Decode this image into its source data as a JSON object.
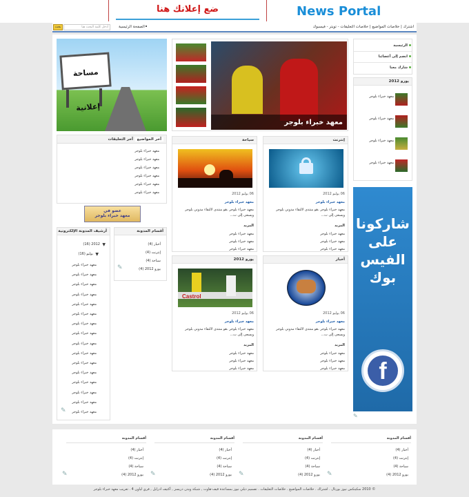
{
  "header": {
    "ad_text": "ضع إعلانك هنا",
    "logo_text": "News Portal"
  },
  "nav": {
    "left_item": "الصفحة الرئيسية",
    "search_button": "بحث",
    "search_placeholder": "أدخل كلمة البحث هنا",
    "right_links": "اشترك | خلاصات المواضيع | خلاصات التعليقات - تويتر - فيسبوك"
  },
  "right_sidebar": {
    "menu": [
      "الرئيسية",
      "انضم إلى أعضائنا",
      "شارك معنا"
    ],
    "section_title": "يورو 2012",
    "items": [
      "معهد خبراء بلوجر",
      "معهد خبراء بلوجر",
      "معهد خبراء بلوجر",
      "معهد خبراء بلوجر"
    ],
    "facebook_banner": "شاركونا على الفيس بوك",
    "facebook_logo": "f"
  },
  "slider": {
    "caption": "معهد خبراء بلوجر"
  },
  "left_sidebar": {
    "ad_label": "مساحة إعلانية",
    "tab_latest": "آخر المواضيع",
    "tab_comments": "آخر التعليقات",
    "latest": [
      "معهد خبراء بلوجر",
      "معهد خبراء بلوجر",
      "معهد خبراء بلوجر",
      "معهد خبراء بلوجر",
      "معهد خبراء بلوجر",
      "معهد خبراء بلوجر"
    ],
    "member_badge_line1": "عضو في",
    "member_badge_line2": "معهد خبراء بلوجر",
    "categories_title": "أقسام المدونة",
    "categories": [
      "أخبار (4)",
      "إنترنت (4)",
      "سياحة (4)",
      "يورو 2012 (4)"
    ],
    "archive_title": "أرشيف المدونة الإلكترونية",
    "archive_year": "2012 (16)",
    "archive_month": "يوليو (16)",
    "archive_posts": [
      "معهد خبراء بلوجر",
      "معهد خبراء بلوجر",
      "معهد خبراء بلوجر",
      "معهد خبراء بلوجر",
      "معهد خبراء بلوجر",
      "معهد خبراء بلوجر",
      "معهد خبراء بلوجر",
      "معهد خبراء بلوجر",
      "معهد خبراء بلوجر",
      "معهد خبراء بلوجر",
      "معهد خبراء بلوجر",
      "معهد خبراء بلوجر",
      "معهد خبراء بلوجر",
      "معهد خبراء بلوجر",
      "معهد خبراء بلوجر",
      "معهد خبراء بلوجر"
    ]
  },
  "posts": [
    {
      "category": "إنترنت",
      "date": "06 يوليو 2012",
      "title": "معهد خبراء بلوجر",
      "excerpt": "معهد خبراء بلوجر ،هو منتدى لالتقاء مدوني بلوجر ويسعى إلى ت...",
      "more": "المزيد",
      "related": [
        "معهد خبراء بلوجر",
        "معهد خبراء بلوجر",
        "معهد خبراء بلوجر"
      ]
    },
    {
      "category": "سياحة",
      "date": "06 يوليو 2012",
      "title": "معهد خبراء بلوجر",
      "excerpt": "معهد خبراء بلوجر ،هو منتدى لالتقاء مدوني بلوجر ويسعى إلى ت...",
      "more": "المزيد",
      "related": [
        "معهد خبراء بلوجر",
        "معهد خبراء بلوجر",
        "معهد خبراء بلوجر"
      ]
    },
    {
      "category": "أخبار",
      "date": "06 يوليو 2012",
      "title": "معهد خبراء بلوجر",
      "excerpt": "معهد خبراء بلوجر ،هو منتدى لالتقاء مدوني بلوجر ويسعى إلى ت...",
      "more": "المزيد",
      "related": [
        "معهد خبراء بلوجر",
        "معهد خبراء بلوجر",
        "معهد خبراء بلوجر"
      ]
    },
    {
      "category": "يورو 2012",
      "date": "06 يوليو 2012",
      "title": "معهد خبراء بلوجر",
      "excerpt": "معهد خبراء بلوجر ،هو منتدى لالتقاء مدوني بلوجر ويسعى إلى ت...",
      "more": "المزيد",
      "related": [
        "معهد خبراء بلوجر",
        "معهد خبراء بلوجر",
        "معهد خبراء بلوجر"
      ]
    }
  ],
  "footer": {
    "title": "أقسام المدونة",
    "categories": [
      "أخبار (4)",
      "إنترنت (4)",
      "سياحة (4)",
      "يورو 2012 (4)"
    ],
    "copyright": "© 2010 سكينكس نيوز بورتال . اشتراك . خلاصات المواضيع . خلاصات التعليقات . تصميم ديلي نيوز بمساعدة قيف-هاوت , شبكة ويدن دريسز , أكثيف ادرايل , فري لياون 4 . تعريب معهد خبراء بلوجر"
  },
  "colors": {
    "accent": "#1a8ed8",
    "ad_red": "#d01818",
    "nav_border": "#5a86c0",
    "facebook_blue": "#2a7cc0"
  }
}
